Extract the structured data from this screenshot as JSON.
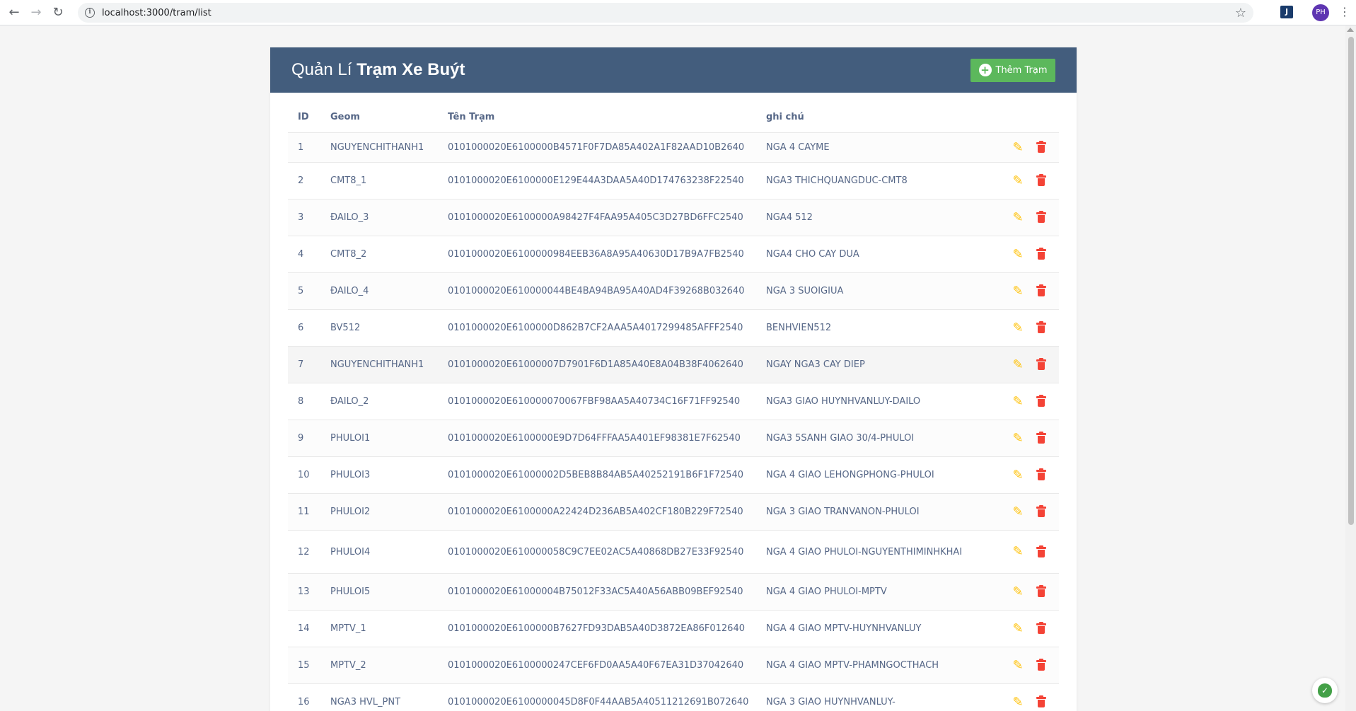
{
  "browser": {
    "back_icon": "←",
    "forward_icon": "→",
    "reload_icon": "↻",
    "info_icon": "i",
    "url": "localhost:3000/tram/list",
    "star_icon": "☆",
    "extension_label": "J",
    "profile_initials": "PH",
    "menu_icon": "⋮"
  },
  "header": {
    "title_prefix": "Quản Lí ",
    "title_bold": "Trạm Xe Buýt",
    "add_button_label": "Thêm Trạm",
    "add_icon": "+"
  },
  "table": {
    "columns": [
      "ID",
      "Geom",
      "Tên Trạm",
      "ghi chú"
    ],
    "rows": [
      {
        "id": "1",
        "geom": "NGUYENCHITHANH1",
        "ten": "0101000020E6100000B4571F0F7DA85A402A1F82AAD10B2640",
        "note": "NGA 4 CAYME"
      },
      {
        "id": "2",
        "geom": "CMT8_1",
        "ten": "0101000020E6100000E129E44A3DAA5A40D174763238F22540",
        "note": "NGA3 THICHQUANGDUC-CMT8"
      },
      {
        "id": "3",
        "geom": "ĐAILO_3",
        "ten": "0101000020E6100000A98427F4FAA95A405C3D27BD6FFC2540",
        "note": "NGA4 512"
      },
      {
        "id": "4",
        "geom": "CMT8_2",
        "ten": "0101000020E6100000984EEB36A8A95A40630D17B9A7FB2540",
        "note": "NGA4 CHO CAY DUA"
      },
      {
        "id": "5",
        "geom": "ĐAILO_4",
        "ten": "0101000020E610000044BE4BA94BA95A40AD4F39268B032640",
        "note": "NGA 3 SUOIGIUA"
      },
      {
        "id": "6",
        "geom": "BV512",
        "ten": "0101000020E6100000D862B7CF2AAA5A4017299485AFFF2540",
        "note": "BENHVIEN512"
      },
      {
        "id": "7",
        "geom": "NGUYENCHITHANH1",
        "ten": "0101000020E61000007D7901F6D1A85A40E8A04B38F4062640",
        "note": "NGAY NGA3 CAY DIEP"
      },
      {
        "id": "8",
        "geom": "ĐAILO_2",
        "ten": "0101000020E610000070067FBF98AA5A40734C16F71FF92540",
        "note": "NGA3 GIAO HUYNHVANLUY-DAILO"
      },
      {
        "id": "9",
        "geom": "PHULOI1",
        "ten": "0101000020E6100000E9D7D64FFFAA5A401EF98381E7F62540",
        "note": "NGA3 5SANH GIAO 30/4-PHULOI"
      },
      {
        "id": "10",
        "geom": "PHULOI3",
        "ten": "0101000020E61000002D5BEB8B84AB5A40252191B6F1F72540",
        "note": "NGA 4 GIAO LEHONGPHONG-PHULOI"
      },
      {
        "id": "11",
        "geom": "PHULOI2",
        "ten": "0101000020E6100000A22424D236AB5A402CF180B229F72540",
        "note": "NGA 3 GIAO TRANVANON-PHULOI"
      },
      {
        "id": "12",
        "geom": "PHULOI4",
        "ten": "0101000020E610000058C9C7EE02AC5A40868DB27E33F92540",
        "note": "NGA 4 GIAO PHULOI-NGUYENTHIMINHKHAI"
      },
      {
        "id": "13",
        "geom": "PHULOI5",
        "ten": "0101000020E61000004B75012F33AC5A40A56ABB09BEF92540",
        "note": "NGA 4 GIAO PHULOI-MPTV"
      },
      {
        "id": "14",
        "geom": "MPTV_1",
        "ten": "0101000020E6100000B7627FD93DAB5A40D3872EA86F012640",
        "note": "NGA 4 GIAO MPTV-HUYNHVANLUY"
      },
      {
        "id": "15",
        "geom": "MPTV_2",
        "ten": "0101000020E6100000247CEF6FD0AA5A40F67EA31D37042640",
        "note": "NGA 4 GIAO MPTV-PHAMNGOCTHACH"
      },
      {
        "id": "16",
        "geom": "NGA3 HVL_PNT",
        "ten": "0101000020E6100000045D8F0F44AAB5A40511212691B072640",
        "note": "NGA 3 GIAO HUYNHVANLUY-"
      }
    ],
    "edit_icon": "✎"
  },
  "security_badge_icon": "✓"
}
